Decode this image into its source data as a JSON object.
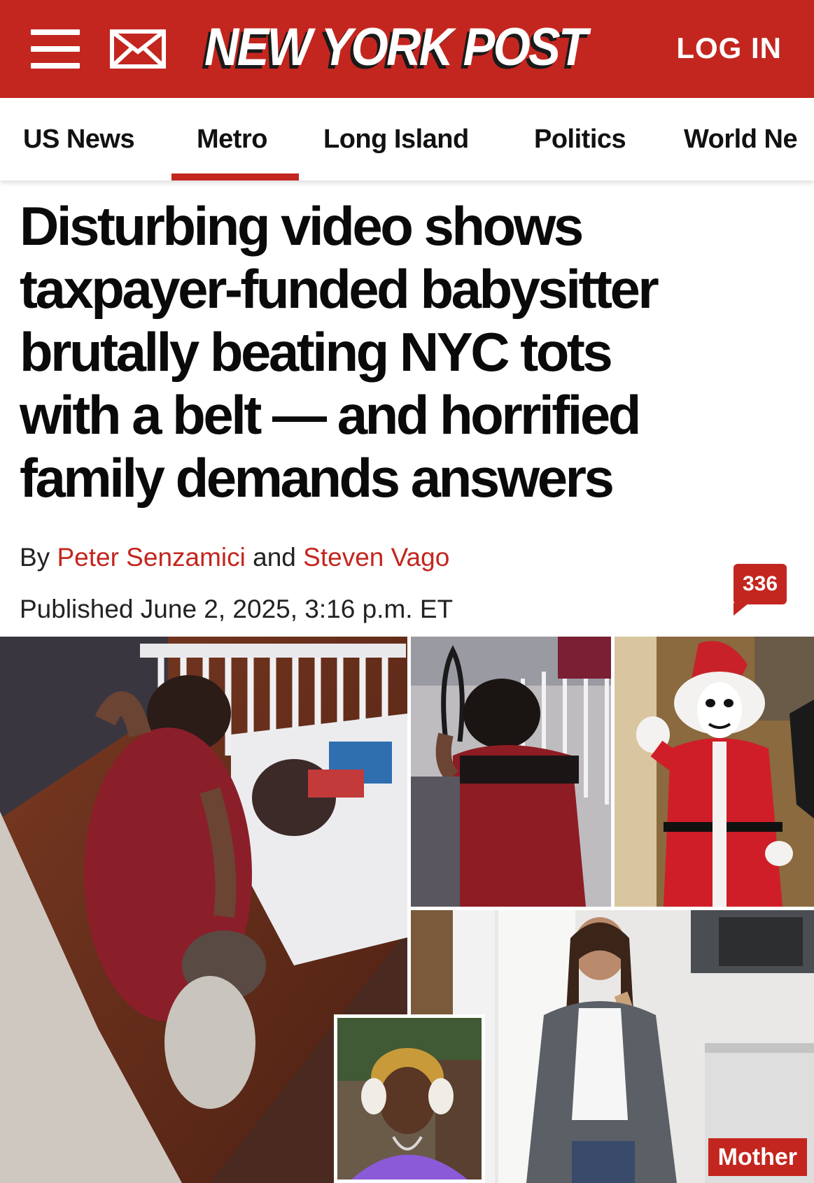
{
  "header": {
    "logo_text": "NEW YORK POST",
    "login_label": "LOG IN",
    "brand_color": "#c3261f"
  },
  "nav": {
    "items": [
      {
        "label": "US News"
      },
      {
        "label": "Metro",
        "active": true
      },
      {
        "label": "Long Island"
      },
      {
        "label": "Politics"
      },
      {
        "label": "World Ne"
      }
    ]
  },
  "article": {
    "headline_lines": [
      "Disturbing video shows",
      "taxpayer-funded babysitter",
      "brutally beating NYC tots",
      "with a belt — and horrified",
      "family demands answers"
    ],
    "byline_prefix": "By ",
    "author_1": "Peter Senzamici",
    "byline_and": " and ",
    "author_2": "Steven Vago",
    "published": "Published June 2, 2025, 3:16 p.m. ET",
    "comment_count": "336"
  },
  "photos": {
    "mother_caption": "Mother"
  },
  "icons": {
    "menu": "hamburger-menu-icon",
    "mail": "envelope-icon",
    "comments": "comment-bubble-icon"
  }
}
